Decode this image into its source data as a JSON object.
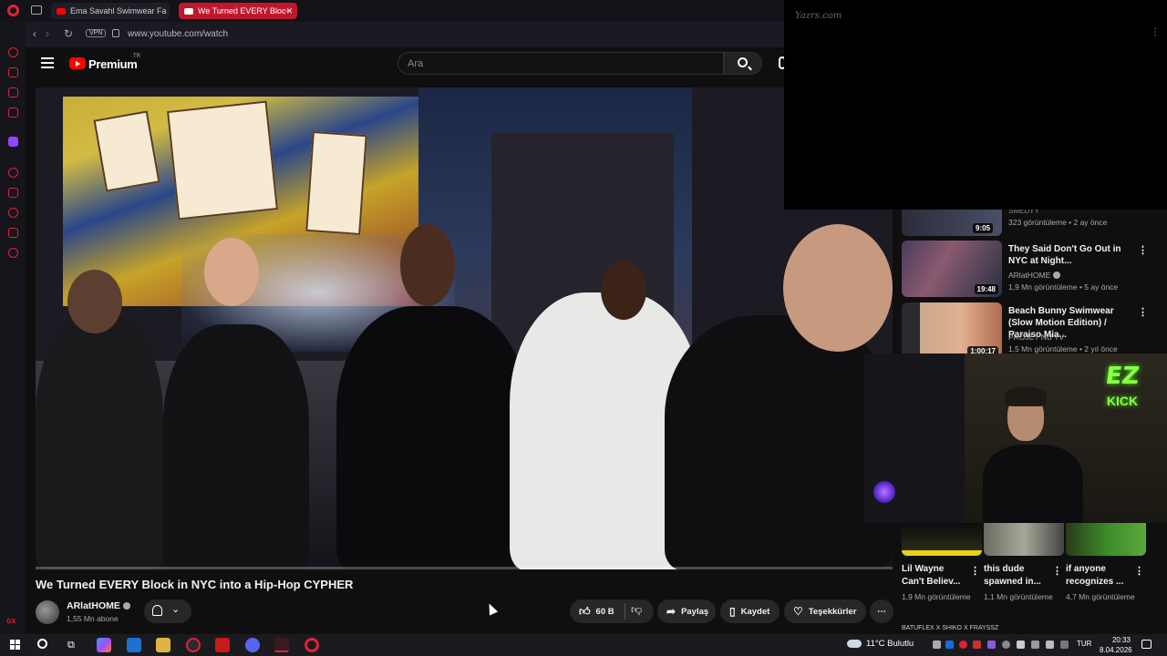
{
  "browser": {
    "tabs": [
      {
        "label": "Ema Savahl Swimwear Fa",
        "active": false
      },
      {
        "label": "We Turned EVERY Bloc",
        "active": true
      }
    ],
    "new_tab_symbol": "+",
    "url": "www.youtube.com/watch",
    "vpn_label": "VPN",
    "gx_label": "GX"
  },
  "youtube": {
    "brand": "Premium",
    "brand_suffix": "TR",
    "search_placeholder": "Ara"
  },
  "overlay": {
    "watermark": "Yazrs.com"
  },
  "video": {
    "title": "We Turned EVERY Block in NYC into a Hip-Hop CYPHER",
    "channel": "ARlatHOME",
    "subscribers": "1,55 Mn abone",
    "likes": "60 B",
    "share_label": "Paylaş",
    "save_label": "Kaydet",
    "thanks_label": "Teşekkürler",
    "progress_fraction": 0.0
  },
  "related": {
    "partial": {
      "channel": "SMEDYY",
      "meta": "323 görüntüleme • 2 ay önce",
      "duration": "9:05"
    },
    "items": [
      {
        "title": "They Said Don't Go Out in NYC at Night...",
        "channel": "ARlatHOME",
        "verified": true,
        "meta": "1,9 Mn görüntüleme • 5 ay önce",
        "duration": "19:48"
      },
      {
        "title": "Beach Bunny Swimwear (Slow Motion Edition) / Paraiso Mia...",
        "channel": "PROJET NU TV",
        "verified": false,
        "meta": "1,5 Mn görüntüleme • 2 yıl önce",
        "duration": "1:00:17"
      }
    ]
  },
  "shorts": [
    {
      "title": "Lil Wayne Can't Believ...",
      "views": "1,9 Mn görüntüleme"
    },
    {
      "title": "this dude spawned in...",
      "views": "1,1 Mn görüntüleme"
    },
    {
      "title": "if anyone recognizes ...",
      "views": "4,7 Mn görüntüleme"
    }
  ],
  "related_bottom_text": "BATUFLEX X SHIKO X FRAYSSZ",
  "webcam": {
    "sign_top": "EZ",
    "sign_bottom": "KICK"
  },
  "taskbar": {
    "weather": "11°C  Bulutlu",
    "language": "TUR",
    "time": "20:33",
    "date": "8.04.2026"
  }
}
